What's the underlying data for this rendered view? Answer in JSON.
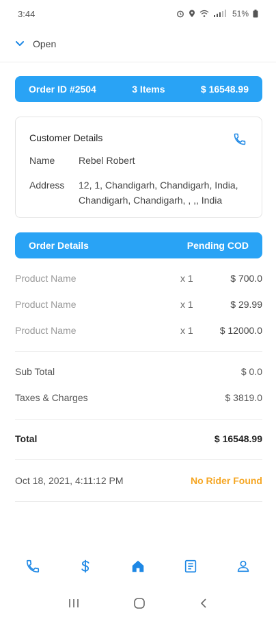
{
  "status_bar": {
    "time": "3:44",
    "battery": "51%"
  },
  "header": {
    "toggle_label": "Open"
  },
  "order_bar": {
    "order_id": "Order ID #2504",
    "items": "3 Items",
    "amount": "$ 16548.99"
  },
  "customer": {
    "title": "Customer Details",
    "name_label": "Name",
    "name_value": "Rebel Robert",
    "address_label": "Address",
    "address_value": "12, 1, Chandigarh, Chandigarh, India, Chandigarh, Chandigarh, , ,, India"
  },
  "order_details_bar": {
    "title": "Order Details",
    "status": "Pending COD"
  },
  "products": [
    {
      "name": "Product Name",
      "qty": "x 1",
      "price": "$ 700.0"
    },
    {
      "name": "Product Name",
      "qty": "x 1",
      "price": "$ 29.99"
    },
    {
      "name": "Product Name",
      "qty": "x 1",
      "price": "$ 12000.0"
    }
  ],
  "summary": {
    "subtotal_label": "Sub Total",
    "subtotal_value": "$ 0.0",
    "taxes_label": "Taxes & Charges",
    "taxes_value": "$ 3819.0",
    "total_label": "Total",
    "total_value": "$ 16548.99"
  },
  "footer_info": {
    "date": "Oct 18, 2021, 4:11:12 PM",
    "rider_status": "No Rider Found"
  },
  "bottom_nav": [
    {
      "icon": "phone-icon"
    },
    {
      "icon": "dollar-icon"
    },
    {
      "icon": "home-icon"
    },
    {
      "icon": "document-icon"
    },
    {
      "icon": "profile-icon"
    }
  ],
  "colors": {
    "accent": "#29a3f5",
    "warning": "#f5a623"
  }
}
